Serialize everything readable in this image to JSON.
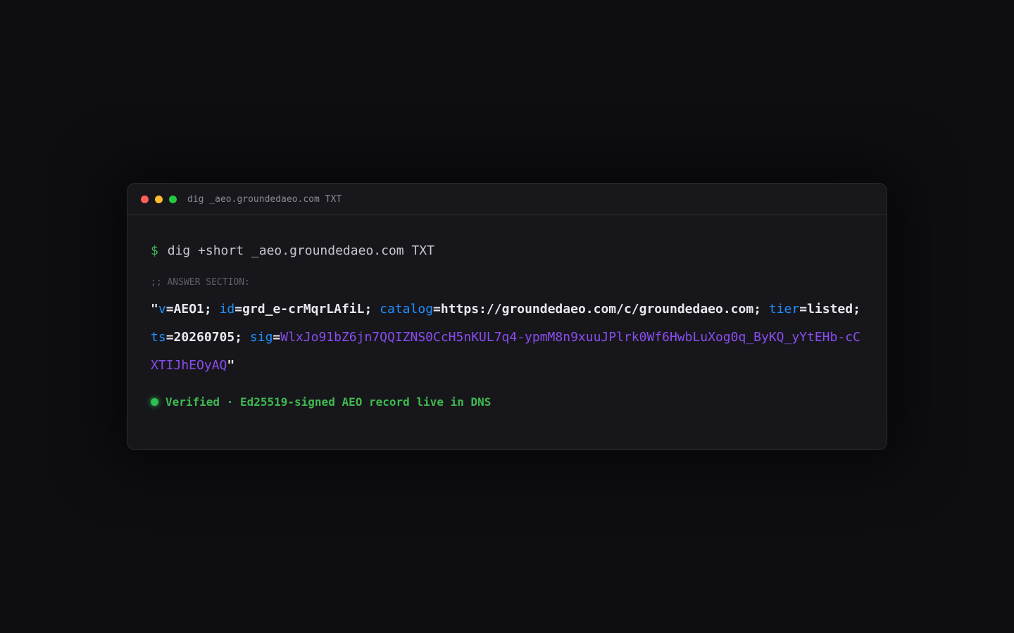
{
  "window": {
    "title": "dig _aeo.groundedaeo.com TXT"
  },
  "terminal": {
    "prompt": "$",
    "command": "dig +short _aeo.groundedaeo.com TXT",
    "answer_label": ";; ANSWER SECTION:",
    "record": {
      "open_quote": "\"",
      "v_key": "v",
      "v_val": "AEO1; ",
      "id_key": "id",
      "id_val": "grd_e-crMqrLAfiL; ",
      "catalog_key": "catalog",
      "catalog_val": "https://groundedaeo.com/c/groundedaeo.com; ",
      "tier_key": "tier",
      "tier_val": "listed; ",
      "ts_key": "ts",
      "ts_val": "20260705; ",
      "sig_key": "sig",
      "sig_val": "WlxJo91bZ6jn7QQIZNS0CcH5nKUL7q4-ypmM8n9xuuJPlrk0Wf6HwbLuXog0q_ByKQ_yYtEHb-cCXTIJhEOyAQ",
      "close_quote": "\""
    },
    "status": {
      "text": "Verified · Ed25519-signed AEO record live in DNS"
    }
  },
  "colors": {
    "background": "#0e0e12",
    "window": "#17171b",
    "key": "#1f8fff",
    "signature": "#8a4cf0",
    "success": "#3fb950"
  }
}
